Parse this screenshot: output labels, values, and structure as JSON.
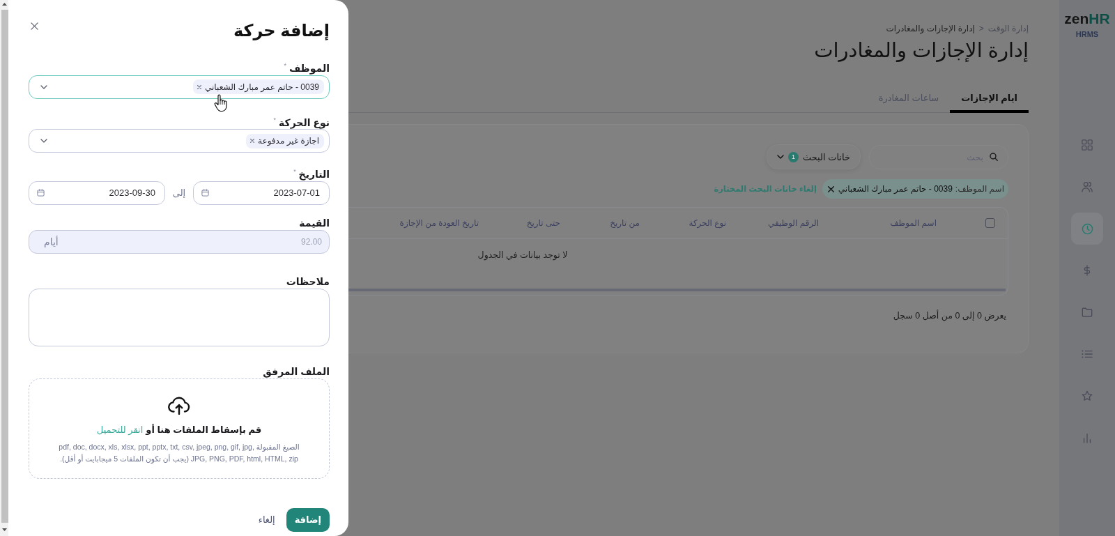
{
  "modal": {
    "title": "إضافة حركة",
    "fields": [
      {
        "kind": "select",
        "label": "الموظف $^{*}$",
        "focused": true,
        "tags": [
          "0039 - حاتم عمر مبارك الشعباني"
        ]
      },
      {
        "kind": "select",
        "label": "نوع الحركة $^{*}$",
        "focused": false,
        "tags": [
          "اجازة غير مدفوعة"
        ]
      },
      {
        "kind": "date_range",
        "label": "التاريخ $^{*}$",
        "from": "2023-07-01",
        "separator": "إلى",
        "to": "2023-09-30"
      },
      {
        "kind": "number",
        "label": "القيمة",
        "value": "92.00",
        "unit": "أيام",
        "disabled": true
      },
      {
        "kind": "textarea",
        "label": "ملاحظات"
      },
      {
        "kind": "file",
        "label": "الملف المرفق",
        "prompt": "قم بإسقاط الملفات هنا أو",
        "link": "انقر للتحميل",
        "formats": "الصيغ المقبولة pdf, doc, docx, xls, xlsx, ppt, pptx, txt, csv, jpeg, png, gif, jpg, JPG, PNG, PDF, html, HTML, zip (يجب أن تكون الملفات 5 ميجابايت أو أقل)."
      }
    ],
    "buttons": [
      {
        "kind": "primary",
        "label": "إضافة"
      },
      {
        "kind": "text",
        "label": "إلغاء"
      }
    ]
  },
  "page": {
    "breadcrumb": [
      "إدارة الوقت",
      "إدارة الإجازات والمغادرات"
    ],
    "breadcrumb_separator": ">",
    "title": "إدارة الإجازات والمغادرات",
    "tabs": [
      {
        "label": "ايام الإجازات",
        "selected": true
      },
      {
        "label": "ساعات المغادرة",
        "selected": false
      }
    ],
    "search": {
      "placeholder": "بحث"
    },
    "filter_button": {
      "label": "خانات البحث",
      "count": "1"
    },
    "active_filters": [
      {
        "label": "اسم الموظف:",
        "value": "0039 - حاتم عمر مبارك الشعباني"
      }
    ],
    "clear_filters": "إلغاء خانات البحث المختارة",
    "table": {
      "select_all": {
        "checked": false
      },
      "columns": [
        "اسم الموظف",
        "الرقم الوظيفي",
        "نوع الحركة",
        "من تاريخ",
        "حتى تاريخ",
        "تاريخ العودة من الإجازة"
      ],
      "empty_message": "لا توجد بيانات في الجدول"
    },
    "pagination_info": "يعرض 0 إلى 0 من أصل 0 سجل"
  },
  "sidebar": {
    "logo": {
      "text": "zen",
      "accent": "HR"
    },
    "product": "HRMS",
    "items": [
      {
        "kind": "grid",
        "selected": false
      },
      {
        "kind": "users",
        "selected": false
      },
      {
        "kind": "clock",
        "selected": true
      },
      {
        "kind": "dollar",
        "selected": false
      },
      {
        "kind": "folder",
        "selected": false
      },
      {
        "kind": "list",
        "selected": false
      },
      {
        "kind": "star",
        "selected": false
      },
      {
        "kind": "chart",
        "selected": false
      }
    ]
  }
}
